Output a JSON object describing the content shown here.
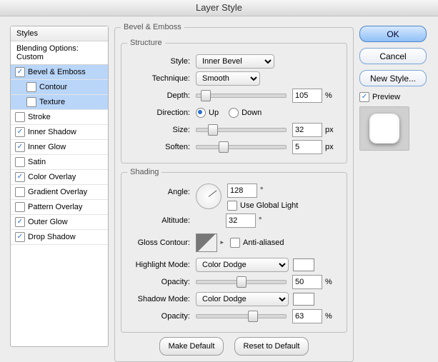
{
  "title": "Layer Style",
  "left": {
    "header": "Styles",
    "blending": "Blending Options: Custom",
    "items": [
      "Bevel & Emboss",
      "Contour",
      "Texture",
      "Stroke",
      "Inner Shadow",
      "Inner Glow",
      "Satin",
      "Color Overlay",
      "Gradient Overlay",
      "Pattern Overlay",
      "Outer Glow",
      "Drop Shadow"
    ]
  },
  "center": {
    "groupTitle": "Bevel & Emboss",
    "structure": {
      "title": "Structure",
      "style_lbl": "Style:",
      "style_val": "Inner Bevel",
      "technique_lbl": "Technique:",
      "technique_val": "Smooth",
      "depth_lbl": "Depth:",
      "depth_val": "105",
      "depth_unit": "%",
      "direction_lbl": "Direction:",
      "up": "Up",
      "down": "Down",
      "size_lbl": "Size:",
      "size_val": "32",
      "soften_lbl": "Soften:",
      "soften_val": "5",
      "px": "px"
    },
    "shading": {
      "title": "Shading",
      "angle_lbl": "Angle:",
      "angle_val": "128",
      "global": "Use Global Light",
      "altitude_lbl": "Altitude:",
      "altitude_val": "32",
      "gloss_lbl": "Gloss Contour:",
      "antialiased": "Anti-aliased",
      "highlight_lbl": "Highlight Mode:",
      "highlight_val": "Color Dodge",
      "shadow_lbl": "Shadow Mode:",
      "shadow_val": "Color Dodge",
      "opacity_lbl": "Opacity:",
      "highlight_opacity": "50",
      "shadow_opacity": "63",
      "pct": "%"
    },
    "make_default": "Make Default",
    "reset_default": "Reset to Default"
  },
  "right": {
    "ok": "OK",
    "cancel": "Cancel",
    "new_style": "New Style...",
    "preview": "Preview"
  }
}
